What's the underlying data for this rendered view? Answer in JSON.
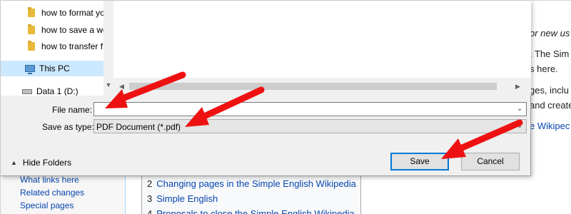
{
  "wiki": {
    "side_texts": [
      "or new us",
      ". The Sim",
      "s here.",
      "ges, inclu",
      "and create",
      "e Wikipec"
    ],
    "toc": [
      {
        "num": "2",
        "label": "Changing pages in the Simple English Wikipedia"
      },
      {
        "num": "3",
        "label": "Simple English"
      },
      {
        "num": "4",
        "label": "Proposals to close the Simple English Wikipedia"
      }
    ],
    "nav_links": [
      "What links here",
      "Related changes",
      "Special pages"
    ]
  },
  "dialog": {
    "nav_tree": {
      "folders": [
        "how to format yo",
        "how to save a we",
        "how to transfer f"
      ],
      "this_pc": "This PC",
      "drive": "Data 1 (D:)"
    },
    "file_name_label": "File name:",
    "file_name_value": "",
    "save_type_label": "Save as type:",
    "save_type_value": "PDF Document (*.pdf)",
    "hide_folders": "Hide Folders",
    "save_button": "Save",
    "cancel_button": "Cancel"
  },
  "colors": {
    "annotation_arrow": "#ee1111",
    "link": "#0645ad",
    "focus_border": "#0078d7"
  }
}
